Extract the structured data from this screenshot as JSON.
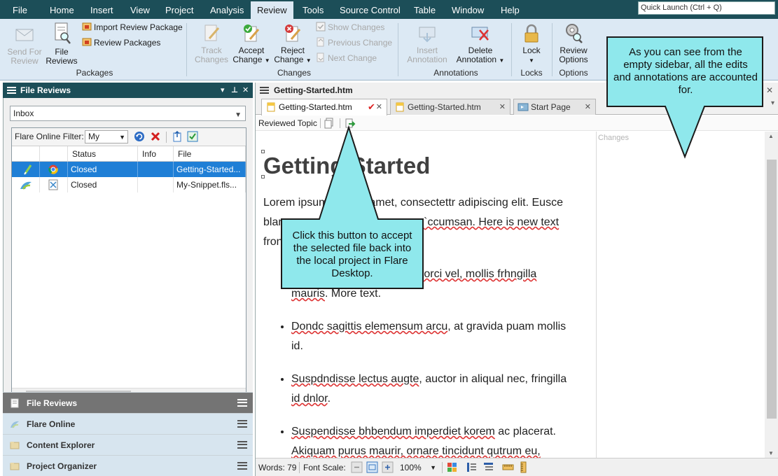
{
  "menubar": {
    "items": [
      "File",
      "Home",
      "Insert",
      "View",
      "Project",
      "Analysis",
      "Review",
      "Tools",
      "Source Control",
      "Table",
      "Window",
      "Help"
    ],
    "active": "Review",
    "quick_launch": "Quick Launch (Ctrl + Q)"
  },
  "ribbon": {
    "send_for_review": "Send For Review",
    "file_reviews": "File Reviews",
    "import_review_package": "Import Review Package",
    "review_packages": "Review Packages",
    "packages_group": "Packages",
    "track_changes": "Track Changes",
    "accept_change": "Accept Change",
    "reject_change": "Reject Change",
    "show_changes": "Show Changes",
    "previous_change": "Previous Change",
    "next_change": "Next Change",
    "changes_group": "Changes",
    "insert_annotation": "Insert Annotation",
    "delete_annotation": "Delete Annotation",
    "annotations_group": "Annotations",
    "lock": "Lock",
    "locks_group": "Locks",
    "review_options": "Review Options",
    "options_group": "Options"
  },
  "left_panel": {
    "title": "File Reviews",
    "header_controls": [
      "▾",
      "⊥",
      "✕"
    ],
    "inbox_value": "Inbox",
    "filter_label": "Flare Online Filter:",
    "filter_value": "My",
    "columns": [
      "",
      "",
      "Status",
      "Info",
      "File"
    ],
    "rows": [
      {
        "status": "Closed",
        "info": "",
        "file": "Getting-Started..."
      },
      {
        "status": "Closed",
        "info": "",
        "file": "My-Snippet.fls..."
      }
    ],
    "accordion": [
      "File Reviews",
      "Flare Online",
      "Content Explorer",
      "Project Organizer"
    ]
  },
  "editor": {
    "title": "Getting-Started.htm",
    "tabs": [
      {
        "label": "Getting-Started.htm",
        "active": true
      },
      {
        "label": "Getting-Started.htm",
        "active": false
      },
      {
        "label": "Start Page",
        "active": false
      }
    ],
    "reviewed_topic_label": "Reviewed Topic",
    "changes_label": "Changes",
    "doc": {
      "heading": "Getting Started",
      "para_1": "Lorem ipsum",
      "para_2": "amet, consectettr adipiscing elit. Eusce",
      "para_3": "blan",
      "para_4": "`ccumsan. Here is new text",
      "para_5": "fron",
      "bullets": [
        [
          "",
          "vek orci vel, mollis frhngilla",
          "mauris",
          ". More text."
        ],
        [
          "Dondc sagittis elemensum arcu",
          ", at gravida puam mollis",
          "id",
          "."
        ],
        [
          "Suspdndisse lectus augte",
          ", auctor in aliqual nec, fringilla",
          "id dnlor",
          "."
        ],
        [
          "Suspendisse bhbendum imperdiet korem",
          " ac placerat.",
          "Akiquam purus maurir, ornare tincidunt qutrum eu,",
          ""
        ]
      ]
    },
    "status": {
      "words": "Words: 79",
      "font_scale": "Font Scale:",
      "zoom": "100%"
    }
  },
  "callouts": {
    "sidebar_note": "As you can see from the empty sidebar, all the edits and annotations are accounted for.",
    "button_note": "Click this button to accept the selected file back into the local project in Flare Desktop."
  },
  "colors": {
    "menubar": "#1c4e58",
    "ribbon": "#dce9f4",
    "callout_fill": "#8fe8ec",
    "selection": "#1f7fd6"
  }
}
